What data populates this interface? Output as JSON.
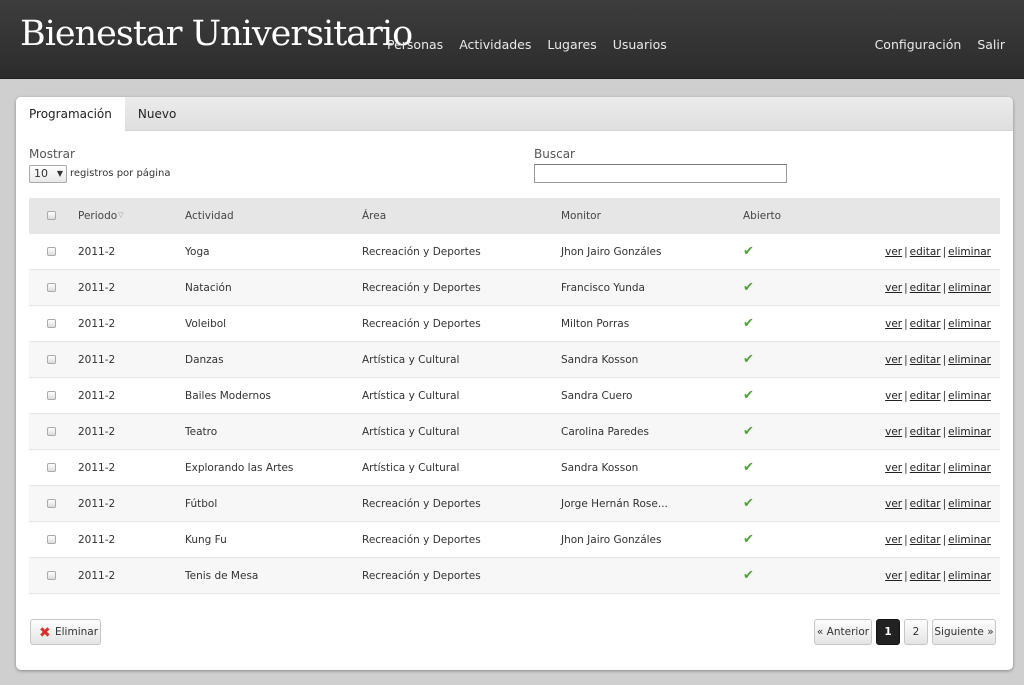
{
  "app": {
    "brand": "Bienestar Universitario",
    "nav_left": [
      "Personas",
      "Actividades",
      "Lugares",
      "Usuarios"
    ],
    "nav_right": [
      "Configuración",
      "Salir"
    ]
  },
  "tabs": [
    "Programación",
    "Nuevo"
  ],
  "controls": {
    "show_label": "Mostrar",
    "page_size": "10",
    "page_size_suffix": "registros por página",
    "search_label": "Buscar",
    "search_value": ""
  },
  "table": {
    "headers": [
      "Periodo",
      "Actividad",
      "Área",
      "Monitor",
      "Abierto"
    ],
    "rows": [
      {
        "periodo": "2011-2",
        "actividad": "Yoga",
        "area": "Recreación y Deportes",
        "monitor": "Jhon Jairo Gonzáles",
        "abierto": "✔"
      },
      {
        "periodo": "2011-2",
        "actividad": "Natación",
        "area": "Recreación y Deportes",
        "monitor": "Francisco Yunda",
        "abierto": "✔"
      },
      {
        "periodo": "2011-2",
        "actividad": "Voleibol",
        "area": "Recreación y Deportes",
        "monitor": "Milton Porras",
        "abierto": "✔"
      },
      {
        "periodo": "2011-2",
        "actividad": "Danzas",
        "area": "Artística y Cultural",
        "monitor": "Sandra Kosson",
        "abierto": "✔"
      },
      {
        "periodo": "2011-2",
        "actividad": "Bailes Modernos",
        "area": "Artística y Cultural",
        "monitor": "Sandra Cuero",
        "abierto": "✔"
      },
      {
        "periodo": "2011-2",
        "actividad": "Teatro",
        "area": "Artística y Cultural",
        "monitor": "Carolina Paredes",
        "abierto": "✔"
      },
      {
        "periodo": "2011-2",
        "actividad": "Explorando las Artes",
        "area": "Artística y Cultural",
        "monitor": "Sandra Kosson",
        "abierto": "✔"
      },
      {
        "periodo": "2011-2",
        "actividad": "Fútbol",
        "area": "Recreación y Deportes",
        "monitor": "Jorge Hernán Rose...",
        "abierto": "✔"
      },
      {
        "periodo": "2011-2",
        "actividad": "Kung Fu",
        "area": "Recreación y Deportes",
        "monitor": "Jhon Jairo Gonzáles",
        "abierto": "✔"
      },
      {
        "periodo": "2011-2",
        "actividad": "Tenis de Mesa",
        "area": "Recreación y Deportes",
        "monitor": "",
        "abierto": "✔"
      }
    ],
    "row_actions": [
      "ver",
      "editar",
      "eliminar"
    ]
  },
  "footer": {
    "delete_label": "Eliminar",
    "prev_label": "« Anterior",
    "pages": [
      "1",
      "2"
    ],
    "current_page": "1",
    "next_label": "Siguiente »"
  },
  "colors": {
    "topbar": "#333333",
    "check": "#4aa43a",
    "delete_icon": "#d9302a",
    "active_page": "#222222"
  }
}
